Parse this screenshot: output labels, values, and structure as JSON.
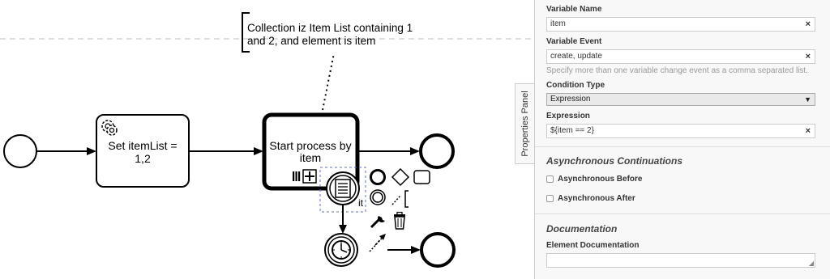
{
  "diagram": {
    "annotation_lines": [
      "Collection iz Item List containing 1",
      "and 2, and element is item"
    ],
    "task1_lines": [
      "Set itemList =",
      "1,2"
    ],
    "task2_lines": [
      "Start process by",
      "item"
    ],
    "partial_label": "it"
  },
  "panel": {
    "tab_label": "Properties Panel",
    "variable_name": {
      "label": "Variable Name",
      "value": "item"
    },
    "variable_event": {
      "label": "Variable Event",
      "value": "create, update",
      "hint": "Specify more than one variable change event as a comma separated list."
    },
    "condition_type": {
      "label": "Condition Type",
      "selected": "Expression"
    },
    "expression": {
      "label": "Expression",
      "value": "${item == 2}"
    },
    "clear_glyph": "×",
    "async_section": {
      "title": "Asynchronous Continuations",
      "before_label": "Asynchronous Before",
      "after_label": "Asynchronous After"
    },
    "doc_section": {
      "title": "Documentation",
      "element_doc_label": "Element Documentation"
    }
  }
}
